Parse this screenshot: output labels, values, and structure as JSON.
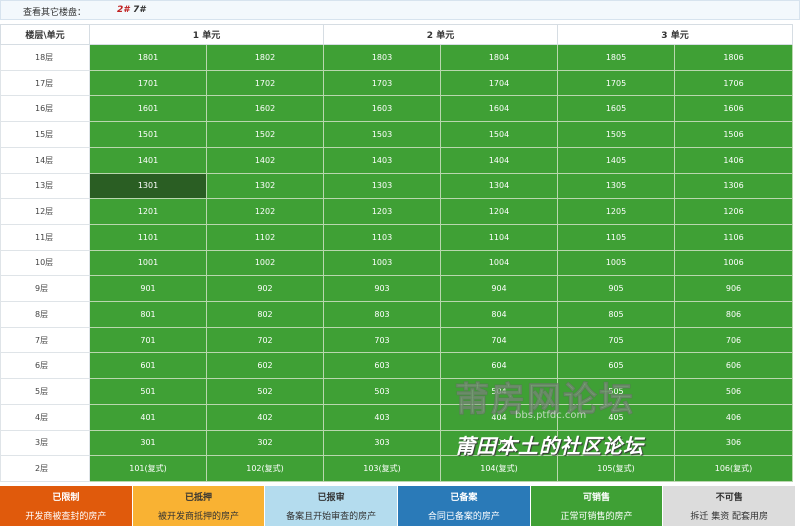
{
  "topbar": {
    "label": "查看其它楼盘：",
    "buildings": [
      "2#",
      "7#"
    ]
  },
  "table": {
    "corner": "楼层\\单元",
    "units": [
      "1 单元",
      "2 单元",
      "3 单元"
    ],
    "selected_room": "1301",
    "rows": [
      {
        "floor": "18层",
        "rooms": [
          "1801",
          "1802",
          "1803",
          "1804",
          "1805",
          "1806"
        ]
      },
      {
        "floor": "17层",
        "rooms": [
          "1701",
          "1702",
          "1703",
          "1704",
          "1705",
          "1706"
        ]
      },
      {
        "floor": "16层",
        "rooms": [
          "1601",
          "1602",
          "1603",
          "1604",
          "1605",
          "1606"
        ]
      },
      {
        "floor": "15层",
        "rooms": [
          "1501",
          "1502",
          "1503",
          "1504",
          "1505",
          "1506"
        ]
      },
      {
        "floor": "14层",
        "rooms": [
          "1401",
          "1402",
          "1403",
          "1404",
          "1405",
          "1406"
        ]
      },
      {
        "floor": "13层",
        "rooms": [
          "1301",
          "1302",
          "1303",
          "1304",
          "1305",
          "1306"
        ]
      },
      {
        "floor": "12层",
        "rooms": [
          "1201",
          "1202",
          "1203",
          "1204",
          "1205",
          "1206"
        ]
      },
      {
        "floor": "11层",
        "rooms": [
          "1101",
          "1102",
          "1103",
          "1104",
          "1105",
          "1106"
        ]
      },
      {
        "floor": "10层",
        "rooms": [
          "1001",
          "1002",
          "1003",
          "1004",
          "1005",
          "1006"
        ]
      },
      {
        "floor": "9层",
        "rooms": [
          "901",
          "902",
          "903",
          "904",
          "905",
          "906"
        ]
      },
      {
        "floor": "8层",
        "rooms": [
          "801",
          "802",
          "803",
          "804",
          "805",
          "806"
        ]
      },
      {
        "floor": "7层",
        "rooms": [
          "701",
          "702",
          "703",
          "704",
          "705",
          "706"
        ]
      },
      {
        "floor": "6层",
        "rooms": [
          "601",
          "602",
          "603",
          "604",
          "605",
          "606"
        ]
      },
      {
        "floor": "5层",
        "rooms": [
          "501",
          "502",
          "503",
          "504",
          "505",
          "506"
        ]
      },
      {
        "floor": "4层",
        "rooms": [
          "401",
          "402",
          "403",
          "404",
          "405",
          "406"
        ]
      },
      {
        "floor": "3层",
        "rooms": [
          "301",
          "302",
          "303",
          "304",
          "305",
          "306"
        ]
      },
      {
        "floor": "2层",
        "rooms": [
          "101(复式)",
          "102(复式)",
          "103(复式)",
          "104(复式)",
          "105(复式)",
          "106(复式)"
        ]
      }
    ]
  },
  "watermark": {
    "title": "莆房网论坛",
    "url": "bbs.ptfdc.com",
    "slogan": "莆田本土的社区论坛"
  },
  "legend": [
    {
      "title": "已限制",
      "desc": "开发商被查封的房产",
      "bg": "#e05a0c",
      "fg": "#ffffff"
    },
    {
      "title": "已抵押",
      "desc": "被开发商抵押的房产",
      "bg": "#f9b233",
      "fg": "#333333"
    },
    {
      "title": "已报审",
      "desc": "备案且开始审查的房产",
      "bg": "#b4dcee",
      "fg": "#333333"
    },
    {
      "title": "已备案",
      "desc": "合同已备案的房产",
      "bg": "#2a7ab8",
      "fg": "#ffffff"
    },
    {
      "title": "可销售",
      "desc": "正常可销售的房产",
      "bg": "#3fa035",
      "fg": "#ffffff"
    },
    {
      "title": "不可售",
      "desc": "拆迁 集资 配套用房",
      "bg": "#dcdcdc",
      "fg": "#333333"
    }
  ]
}
